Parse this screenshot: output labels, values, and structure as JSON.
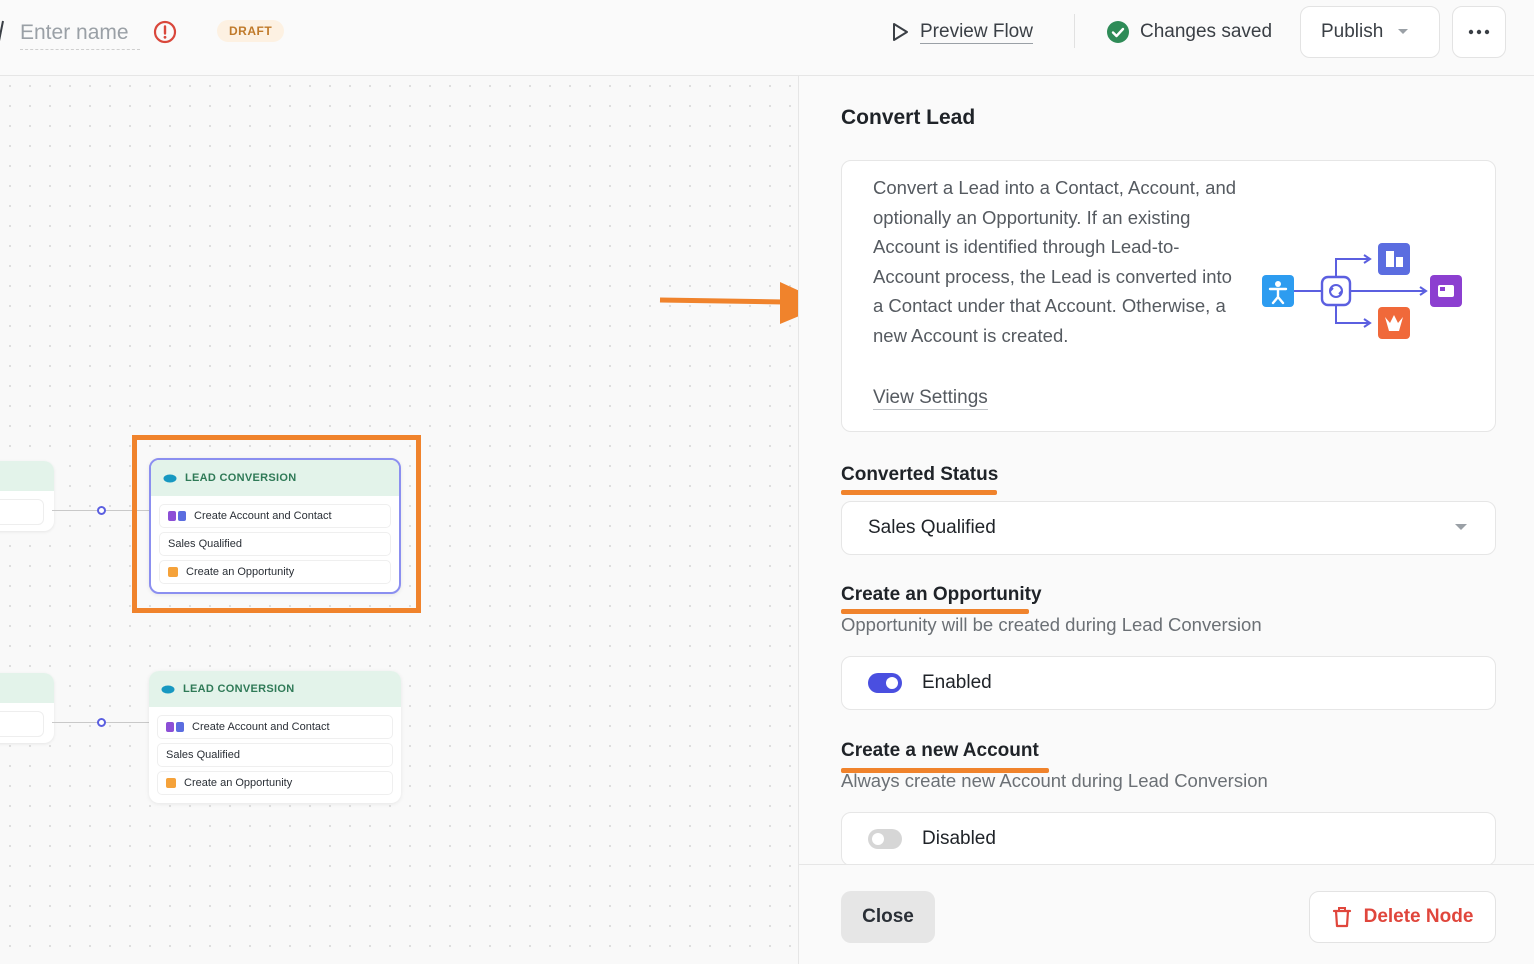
{
  "topbar": {
    "name_placeholder": "Enter name",
    "status_badge": "DRAFT",
    "preview_label": "Preview Flow",
    "saved_label": "Changes saved",
    "publish_label": "Publish"
  },
  "canvas": {
    "nodes": [
      {
        "header": "LEAD CONVERSION",
        "items": [
          "Create Account and Contact",
          "Sales Qualified",
          "Create an Opportunity"
        ],
        "selected": true
      },
      {
        "header": "LEAD CONVERSION",
        "items": [
          "Create Account and Contact",
          "Sales Qualified",
          "Create an Opportunity"
        ],
        "selected": false
      }
    ]
  },
  "panel": {
    "title": "Convert Lead",
    "description": "Convert a Lead into a Contact, Account, and optionally an Opportunity. If an existing Account is identified through Lead-to-Account process, the Lead is converted into a Contact under that Account. Otherwise, a new Account is created.",
    "view_settings": "View Settings",
    "converted_status": {
      "title": "Converted Status",
      "value": "Sales Qualified"
    },
    "create_opportunity": {
      "title": "Create an Opportunity",
      "subtitle": "Opportunity will be created during Lead Conversion",
      "toggle_label": "Enabled",
      "enabled": true
    },
    "create_account": {
      "title": "Create a new Account",
      "subtitle": "Always create new Account during Lead Conversion",
      "toggle_label": "Disabled",
      "enabled": false
    },
    "close_label": "Close",
    "delete_label": "Delete Node"
  },
  "colors": {
    "accent": "#4a4fe0",
    "annotation": "#f0832c",
    "danger": "#e0463c",
    "success": "#2e8b57",
    "node_header": "#e3f3ea"
  }
}
